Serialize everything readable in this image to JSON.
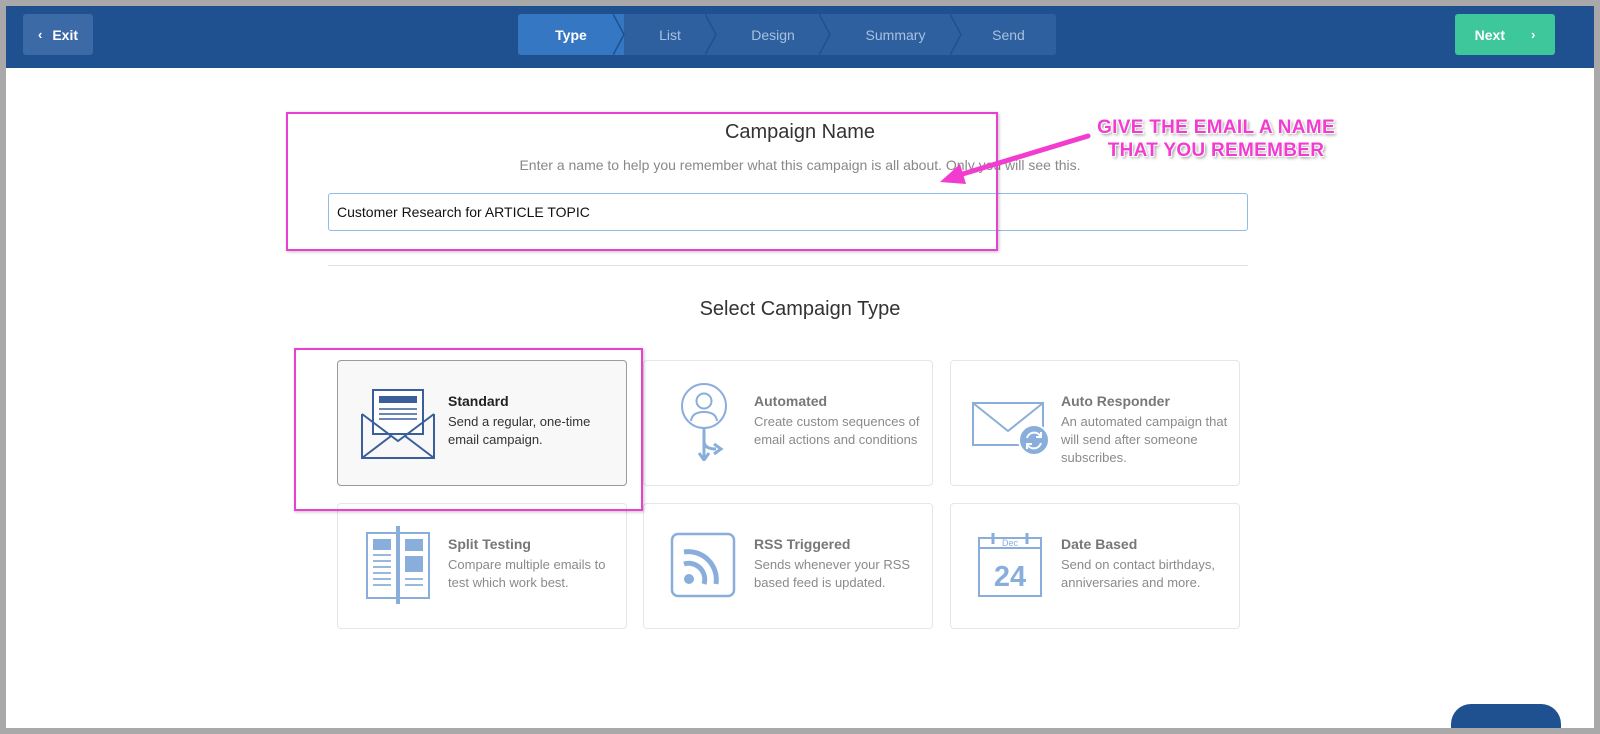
{
  "header": {
    "exit_label": "Exit",
    "next_label": "Next",
    "steps": [
      {
        "label": "Type",
        "active": true
      },
      {
        "label": "List",
        "active": false
      },
      {
        "label": "Design",
        "active": false
      },
      {
        "label": "Summary",
        "active": false
      },
      {
        "label": "Send",
        "active": false
      }
    ]
  },
  "campaign_name": {
    "title": "Campaign Name",
    "help_text": "Enter a name to help you remember what this campaign is all about. Only you will see this.",
    "input_value": "Customer Research for ARTICLE TOPIC"
  },
  "campaign_type": {
    "title": "Select Campaign Type",
    "cards": [
      {
        "title": "Standard",
        "desc": "Send a regular, one-time email campaign.",
        "icon": "envelope-letter-icon",
        "selected": true
      },
      {
        "title": "Automated",
        "desc": "Create custom sequences of email actions and conditions",
        "icon": "person-branch-icon",
        "selected": false
      },
      {
        "title": "Auto Responder",
        "desc": "An automated campaign that will send after someone subscribes.",
        "icon": "envelope-refresh-icon",
        "selected": false
      },
      {
        "title": "Split Testing",
        "desc": "Compare multiple emails to test which work best.",
        "icon": "split-document-icon",
        "selected": false
      },
      {
        "title": "RSS Triggered",
        "desc": "Sends whenever your RSS based feed is updated.",
        "icon": "rss-icon",
        "selected": false
      },
      {
        "title": "Date Based",
        "desc": "Send on contact birthdays, anniversaries and more.",
        "icon": "calendar-icon",
        "selected": false,
        "calendar_month": "Dec",
        "calendar_day": "24"
      }
    ]
  },
  "annotation": {
    "line1": "GIVE THE EMAIL A NAME",
    "line2": "THAT YOU REMEMBER",
    "color": "#f23ccf"
  },
  "colors": {
    "topbar": "#1f5090",
    "step_active": "#3577c2",
    "next_button": "#3ec79a",
    "icon_blue": "#8aaedb",
    "icon_dark_blue": "#3b5f9a"
  }
}
